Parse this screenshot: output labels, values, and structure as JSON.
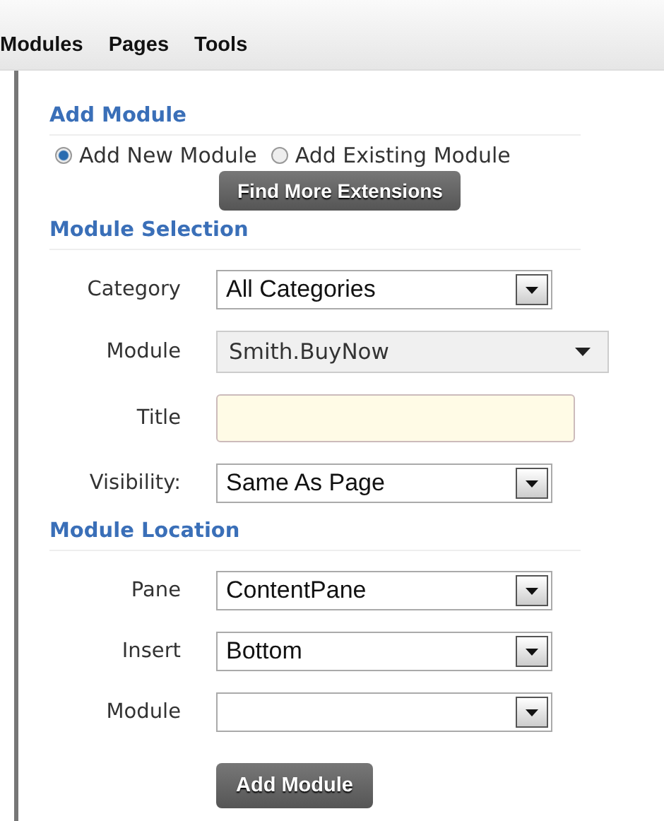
{
  "menu": [
    {
      "label": "Modules"
    },
    {
      "label": "Pages"
    },
    {
      "label": "Tools"
    }
  ],
  "add_module": {
    "heading": "Add Module",
    "options": [
      {
        "label": "Add New Module",
        "selected": true
      },
      {
        "label": "Add Existing Module",
        "selected": false
      }
    ],
    "button": "Find More Extensions"
  },
  "module_selection": {
    "heading": "Module Selection",
    "fields": [
      {
        "label": "Category",
        "kind": "select",
        "value": "All Categories"
      },
      {
        "label": "Module",
        "kind": "combo",
        "value": "Smith.BuyNow"
      },
      {
        "label": "Title",
        "kind": "text"
      },
      {
        "label": "Visibility:",
        "kind": "select",
        "value": "Same As Page"
      }
    ]
  },
  "module_location": {
    "heading": "Module Location",
    "fields": [
      {
        "label": "Pane",
        "kind": "select",
        "value": "ContentPane"
      },
      {
        "label": "Insert",
        "kind": "select",
        "value": "Bottom"
      },
      {
        "label": "Module",
        "kind": "select"
      }
    ],
    "button": "Add Module"
  }
}
